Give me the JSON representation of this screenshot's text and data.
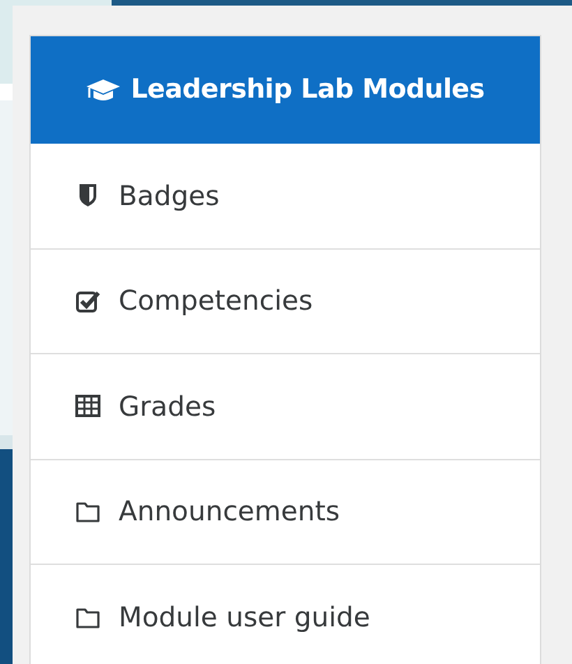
{
  "header": {
    "title": "Leadership Lab Modules"
  },
  "items": [
    {
      "label": "Badges",
      "kind": "shield"
    },
    {
      "label": "Competencies",
      "kind": "checkbox"
    },
    {
      "label": "Grades",
      "kind": "table"
    },
    {
      "label": "Announcements",
      "kind": "folder"
    },
    {
      "label": "Module user guide",
      "kind": "folder"
    }
  ]
}
